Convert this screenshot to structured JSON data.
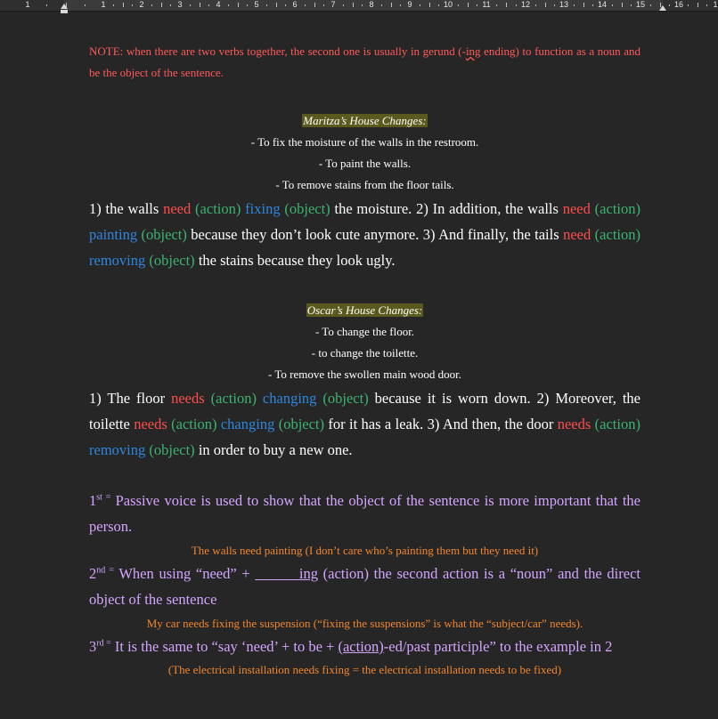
{
  "ruler": {
    "labels": [
      "1",
      "1",
      "2",
      "3",
      "4",
      "5",
      "6",
      "7",
      "8",
      "9",
      "10",
      "11",
      "12",
      "13",
      "14",
      "15",
      "16",
      "1"
    ]
  },
  "note": {
    "text_before": "NOTE: when there are two verbs together, the second one is usually in gerund (-",
    "underlined": "ing",
    "text_after": " ending) to function as a noun and be the object of the sentence."
  },
  "maritza": {
    "heading": "Maritza’s House Changes:",
    "items": [
      "- To fix the moisture of the walls in the restroom.",
      "-  To paint the walls.",
      "-  To remove stains from the floor tails."
    ],
    "para": {
      "s1": "1) the walls ",
      "v1": "need",
      "a1": " (action) ",
      "g1": "fixing",
      "o1": " (object)",
      "s2": " the moisture. 2) In addition, the walls ",
      "v2": "need",
      "a2": " (action) ",
      "g2": "painting",
      "o2": " (object)",
      "s3": " because they don’t look cute anymore. 3) And finally, the tails ",
      "v3": "need",
      "a3": " (action) ",
      "g3": "removing",
      "o3": " (object)",
      "s4": " the stains because they look ugly."
    }
  },
  "oscar": {
    "heading": "Oscar’s House Changes:",
    "items": [
      "- To change the floor.",
      "- to change the toilette.",
      "- To remove the swollen main wood door."
    ],
    "para": {
      "s1": "1) The floor ",
      "v1": "needs",
      "a1": " (action) ",
      "g1": "changing",
      "o1": " (object)",
      "s2": " because it is worn down. 2) Moreover, the toilette ",
      "v2": "needs",
      "a2": " (action) ",
      "g2": "changing",
      "o2": " (object)",
      "s3": " for it has a leak. 3) And then, the door ",
      "v3": "needs",
      "a3": " (action) ",
      "g3": "removing",
      "o3": " (object)",
      "s4": " in order to buy a new one."
    }
  },
  "rules": {
    "r1": {
      "num": "1",
      "sup": "st =",
      "text": " Passive voice is used to show that the object of the sentence is more important that the person."
    },
    "ex1": "The walls need painting (I don’t care who’s painting them but they need it)",
    "r2": {
      "num": "2",
      "sup": "nd =",
      "pre": " When using “need” + ",
      "blank": "______ing",
      "post": " (action) the second action is a “noun” and the direct object of the sentence"
    },
    "ex2": "My car needs fixing the suspension (“fixing the suspensions” is what the “subject/car” needs).",
    "r3": {
      "num": "3",
      "sup": "rd =",
      "pre": " It is the same to “say ‘need’ + to be + ",
      "under": "(action)",
      "post": "-ed/past participle” to the example in 2"
    },
    "ex3": "(The electrical installation needs fixing = the electrical installation needs to be fixed)"
  }
}
